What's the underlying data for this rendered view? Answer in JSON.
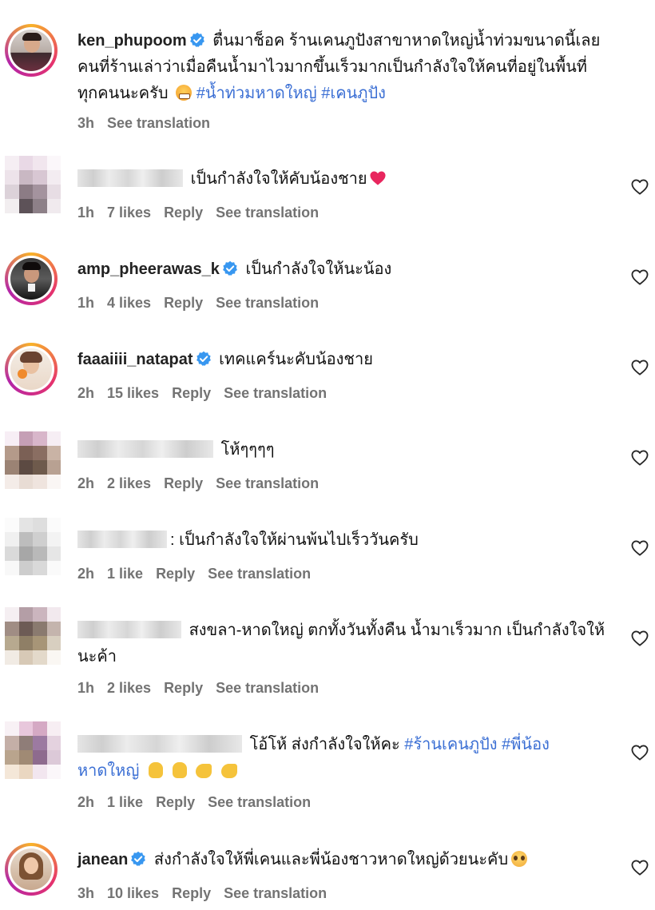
{
  "comments": [
    {
      "username": "ken_phupoom",
      "verified": true,
      "text": "ตื่นมาช็อค ร้านเคนภูปังสาขาหาดใหญ่น้ำท่วมขนาดนี้เลยคนที่ร้านเล่าว่าเมื่อคืนน้ำมาไวมากขึ้นเร็วมากเป็นกำลังใจให้คนที่อยู่ในพื้นที่ทุกคนนะครับ",
      "emoji": "grimace-face",
      "hashtags": [
        "#น้ำท่วมหาดใหญ่",
        "#เคนภูปัง"
      ],
      "time": "3h",
      "likes": "",
      "reply": "",
      "translate": "See translation"
    },
    {
      "username": "",
      "verified": false,
      "text": "เป็นกำลังใจให้คับน้องชาย",
      "emoji": "red-heart",
      "time": "1h",
      "likes": "7 likes",
      "reply": "Reply",
      "translate": "See translation"
    },
    {
      "username": "amp_pheerawas_k",
      "verified": true,
      "text": "เป็นกำลังใจให้นะน้อง",
      "time": "1h",
      "likes": "4 likes",
      "reply": "Reply",
      "translate": "See translation"
    },
    {
      "username": "faaaiiii_natapat",
      "verified": true,
      "text": "เทคแคร์นะคับน้องชาย",
      "time": "2h",
      "likes": "15 likes",
      "reply": "Reply",
      "translate": "See translation"
    },
    {
      "username": "",
      "verified": false,
      "text": "โห้ๆๆๆๆ",
      "time": "2h",
      "likes": "2 likes",
      "reply": "Reply",
      "translate": "See translation"
    },
    {
      "username": "",
      "verified": false,
      "text": ": เป็นกำลังใจให้ผ่านพ้นไปเร็ววันครับ",
      "time": "2h",
      "likes": "1 like",
      "reply": "Reply",
      "translate": "See translation"
    },
    {
      "username": "",
      "verified": false,
      "text": "สงขลา-หาดใหญ่ ตกทั้งวันทั้งคืน น้ำมาเร็วมาก เป็นกำลังใจให้นะค้า",
      "time": "1h",
      "likes": "2 likes",
      "reply": "Reply",
      "translate": "See translation"
    },
    {
      "username": "",
      "verified": false,
      "text": "โอ้โห้ ส่งกำลังใจให้คะ",
      "hashtags": [
        "#ร้านเคนภูปัง",
        "#พี่น้องหาดใหญ่"
      ],
      "emojis": [
        "victory-hand",
        "victory-hand",
        "flexed-biceps",
        "flexed-biceps"
      ],
      "time": "2h",
      "likes": "1 like",
      "reply": "Reply",
      "translate": "See translation"
    },
    {
      "username": "janean",
      "verified": true,
      "text": "ส่งกำลังใจให้พี่เคนและพี่น้องชาวหาดใหญ่ด้วยนะคับ",
      "emoji": "pleading-face",
      "time": "3h",
      "likes": "10 likes",
      "reply": "Reply",
      "translate": "See translation"
    }
  ],
  "icons": {
    "like": "heart-outline-icon",
    "verified": "verified-badge-icon"
  },
  "colors": {
    "hashtag": "#3b6fd4",
    "meta": "#737373",
    "verified": "#3897f0"
  }
}
